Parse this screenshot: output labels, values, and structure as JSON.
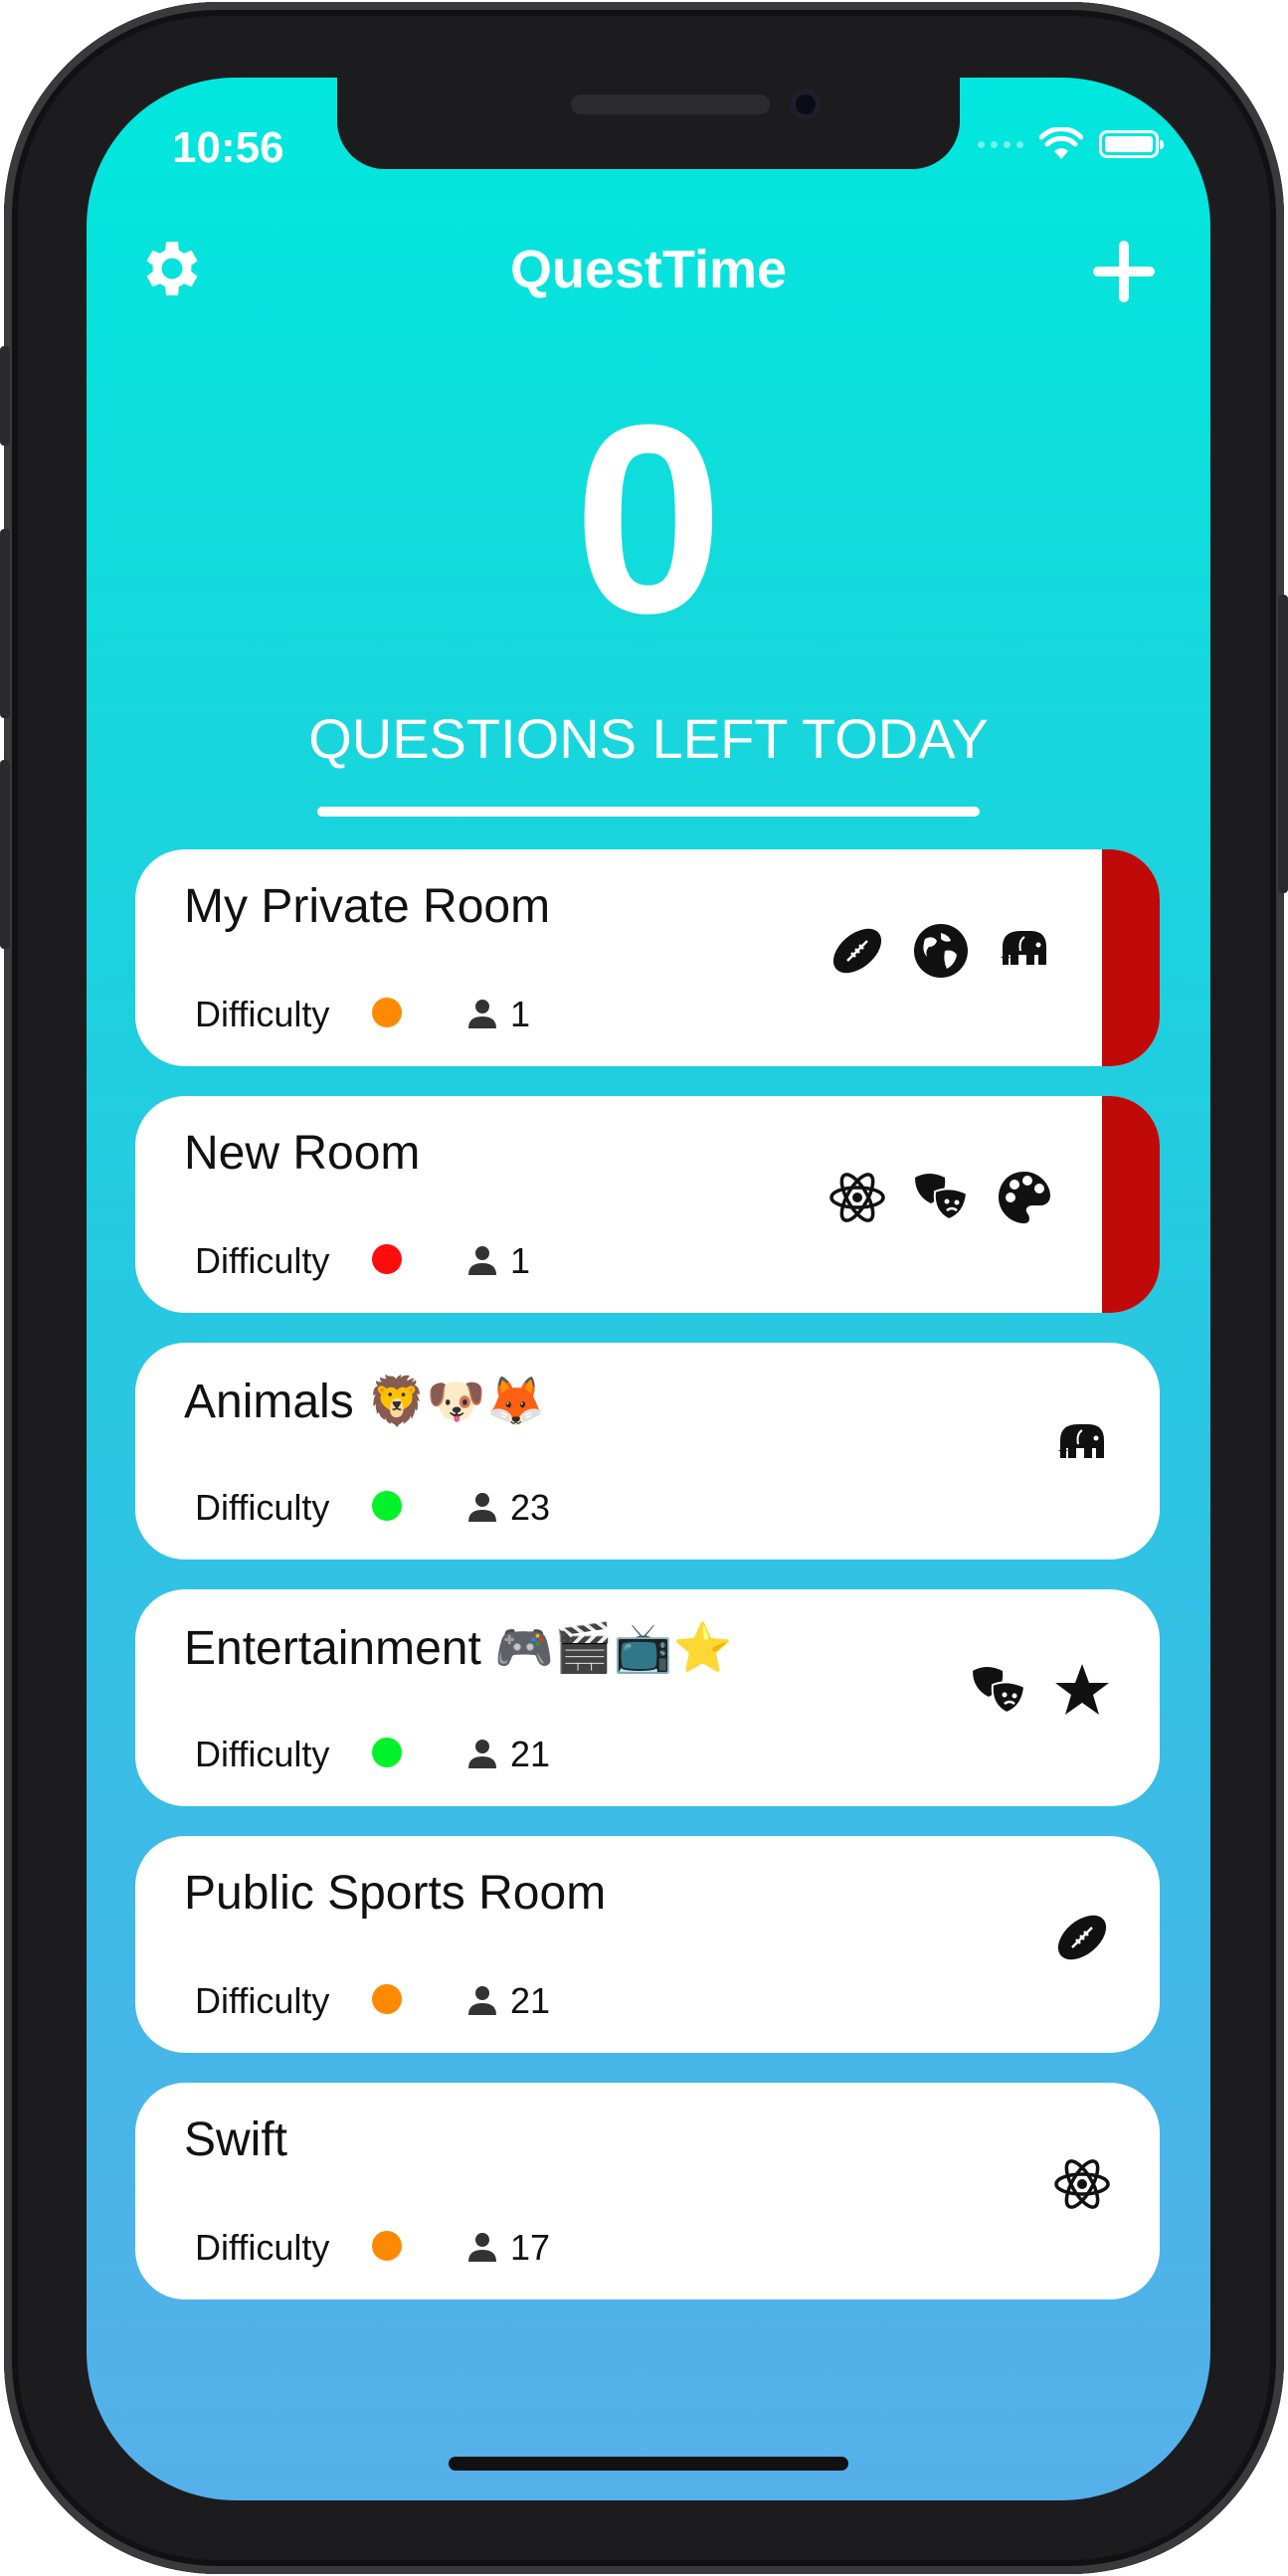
{
  "status_bar": {
    "time": "10:56"
  },
  "nav": {
    "title": "QuestTime",
    "settings_icon": "gear-icon",
    "add_icon": "plus-icon"
  },
  "hero": {
    "count": "0",
    "label": "QUESTIONS LEFT TODAY"
  },
  "colors": {
    "accent_red": "#c00a0a",
    "orange": "#ff8a00",
    "red": "#ff0d0d",
    "green": "#00f22a"
  },
  "rooms": [
    {
      "name": "My Private Room",
      "underline_color": "#f193da",
      "difficulty_label": "Difficulty",
      "difficulty_color": "#ff8a00",
      "members": "1",
      "icons": [
        "football-icon",
        "globe-icon",
        "elephant-icon"
      ],
      "flagged": true
    },
    {
      "name": "New Room",
      "underline_color": "#e818d8",
      "difficulty_label": "Difficulty",
      "difficulty_color": "#ff0d0d",
      "members": "1",
      "icons": [
        "atom-icon",
        "theater-masks-icon",
        "palette-icon"
      ],
      "flagged": true
    },
    {
      "name": "Animals 🦁🐶🦊",
      "underline_color": "#8a6bff",
      "difficulty_label": "Difficulty",
      "difficulty_color": "#00f22a",
      "members": "23",
      "icons": [
        "elephant-icon"
      ],
      "flagged": false
    },
    {
      "name": "Entertainment 🎮🎬📺⭐️",
      "underline_color": "#6a1a8a",
      "difficulty_label": "Difficulty",
      "difficulty_color": "#00f22a",
      "members": "21",
      "icons": [
        "theater-masks-icon",
        "star-icon"
      ],
      "flagged": false
    },
    {
      "name": "Public Sports Room",
      "underline_color": "#a8de3a",
      "difficulty_label": "Difficulty",
      "difficulty_color": "#ff8a00",
      "members": "21",
      "icons": [
        "football-icon"
      ],
      "flagged": false
    },
    {
      "name": "Swift",
      "underline_color": "#6a1a6a",
      "difficulty_label": "Difficulty",
      "difficulty_color": "#ff8a00",
      "members": "17",
      "icons": [
        "atom-icon"
      ],
      "flagged": false
    }
  ]
}
